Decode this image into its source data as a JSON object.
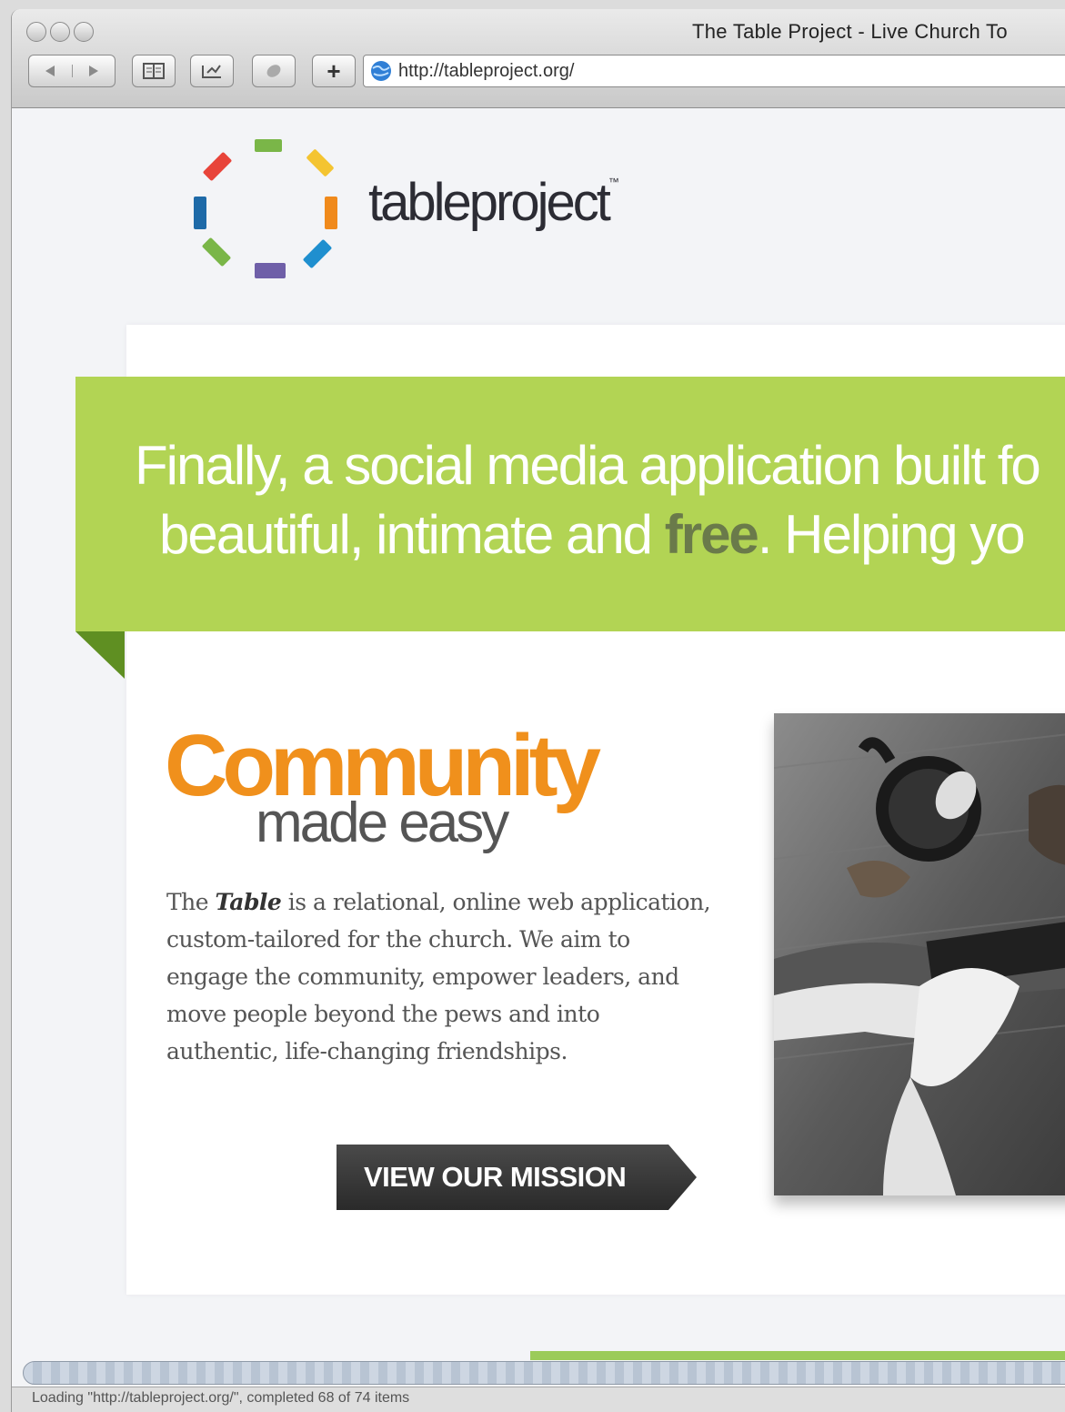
{
  "window": {
    "title": "The Table Project - Live Church To"
  },
  "toolbar": {
    "back_icon": "back-arrow-icon",
    "forward_icon": "forward-arrow-icon",
    "new_tab_label": "+"
  },
  "address_bar": {
    "url": "http://tableproject.org/"
  },
  "page": {
    "logo": {
      "wordmark": "tableproject",
      "trademark": "™",
      "ring_colors": [
        "#7ab648",
        "#f4c431",
        "#f08a1c",
        "#1f8fcf",
        "#6f5fa8",
        "#7ab648",
        "#1e6aa8",
        "#e8443a"
      ]
    },
    "banner": {
      "line1": "Finally, a social media application built fo",
      "line2_before": "beautiful, intimate and ",
      "line2_emphasis": "free",
      "line2_after": ". Helping yo",
      "color": "#b2d454"
    },
    "feature": {
      "heading": "Community",
      "subheading": "made easy",
      "body_before": "The ",
      "body_emphasis": "Table",
      "body_after": " is a relational, online web application, custom-tailored for the church. We aim to engage the community, empower leaders, and move people beyond the pews and into authentic, life-changing friendships.",
      "cta_label": "VIEW OUR MISSION",
      "accent": "#f0901c"
    }
  },
  "status_bar": {
    "text": "Loading \"http://tableproject.org/\", completed 68 of 74 items"
  }
}
